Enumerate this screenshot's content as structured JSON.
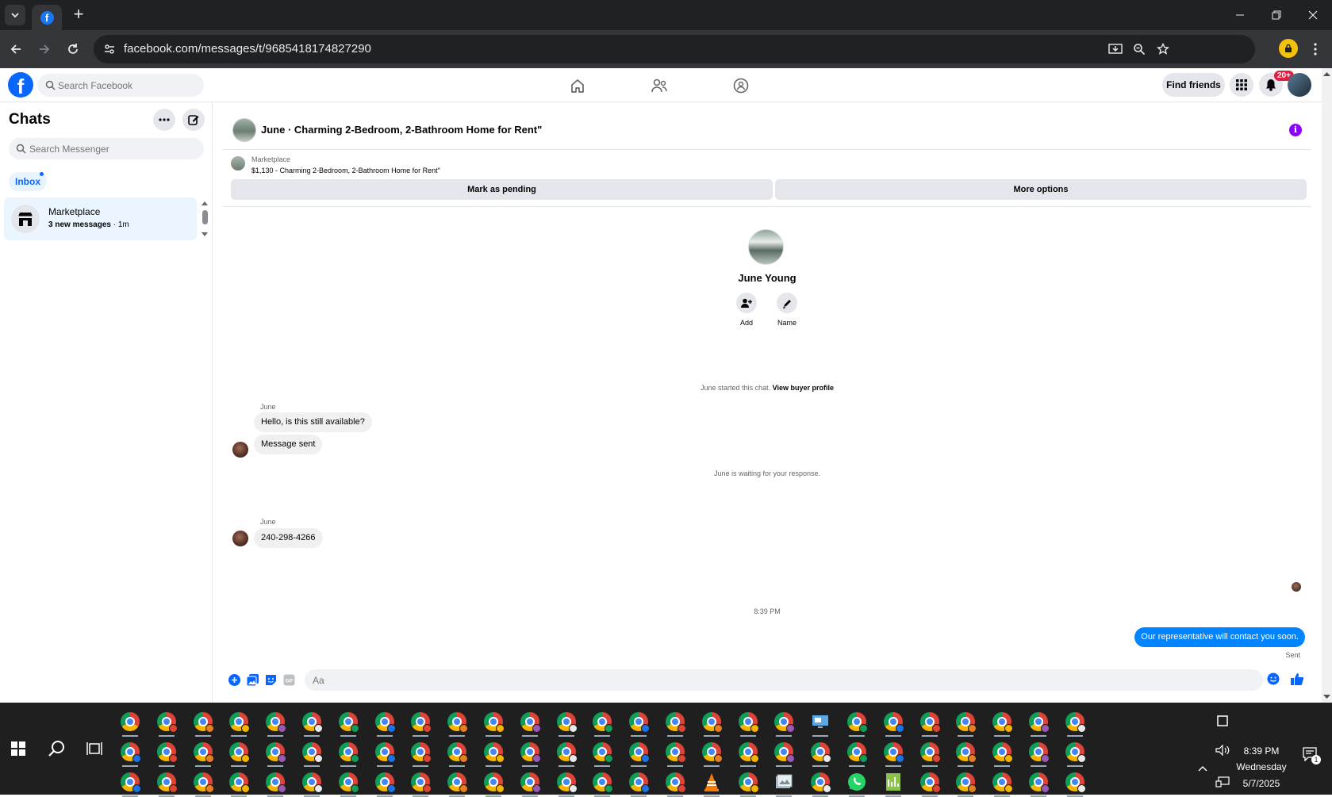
{
  "browser": {
    "url": "facebook.com/messages/t/9685418174827290"
  },
  "fbnav": {
    "logo": "f",
    "search_placeholder": "Search Facebook",
    "find_friends": "Find friends",
    "notification_badge": "20+"
  },
  "sidebar": {
    "title": "Chats",
    "search_placeholder": "Search Messenger",
    "filter_inbox": "Inbox",
    "chats": [
      {
        "name": "Marketplace",
        "unread": "3 new messages",
        "time": "1m"
      }
    ]
  },
  "conversation": {
    "title": "June · Charming 2-Bedroom, 2-Bathroom Home for Rent\"",
    "listing": {
      "source": "Marketplace",
      "description": "$1,130 - Charming 2-Bedroom, 2-Bathroom Home for Rent\"",
      "mark_pending": "Mark as pending",
      "more_options": "More options"
    },
    "profile": {
      "name": "June Young",
      "add_label": "Add",
      "name_label": "Name"
    },
    "started_text": "June started this chat.",
    "view_buyer_profile": "View buyer profile",
    "sender_1": "June",
    "message_1": "Hello, is this still available?",
    "message_2": "Message sent",
    "waiting_text": "June is waiting for your response.",
    "sender_2": "June",
    "message_3": "240-298-4266",
    "timestamp": "8:39 PM",
    "outgoing_message": "Our representative will contact you soon.",
    "sent_status": "Sent",
    "composer_placeholder": "Aa"
  },
  "taskbar": {
    "time": "8:39 PM",
    "day": "Wednesday",
    "date": "5/7/2025",
    "notification_count": "1"
  },
  "colors": {
    "facebook_blue": "#0866ff",
    "outgoing_bubble": "#0084ff",
    "info_purple": "#8b00ff",
    "badge_red": "#e41e3f"
  }
}
